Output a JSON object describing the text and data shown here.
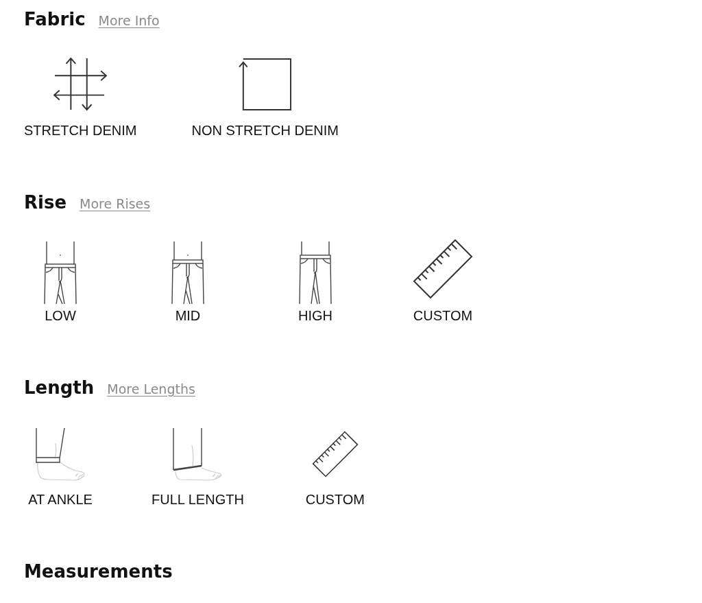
{
  "sections": [
    {
      "title": "Fabric",
      "link": "More Info",
      "options": [
        {
          "label": "STRETCH DENIM",
          "kind": "stretch"
        },
        {
          "label": "NON STRETCH DENIM",
          "kind": "non-stretch"
        }
      ]
    },
    {
      "title": "Rise",
      "link": "More Rises",
      "options": [
        {
          "label": "LOW",
          "kind": "low-rise"
        },
        {
          "label": "MID",
          "kind": "mid-rise"
        },
        {
          "label": "HIGH",
          "kind": "high-rise"
        },
        {
          "label": "CUSTOM",
          "kind": "ruler"
        }
      ]
    },
    {
      "title": "Length",
      "link": "More Lengths",
      "options": [
        {
          "label": "AT ANKLE",
          "kind": "at-ankle"
        },
        {
          "label": "FULL LENGTH",
          "kind": "full-length"
        },
        {
          "label": "CUSTOM",
          "kind": "ruler"
        }
      ]
    },
    {
      "title": "Measurements"
    }
  ]
}
